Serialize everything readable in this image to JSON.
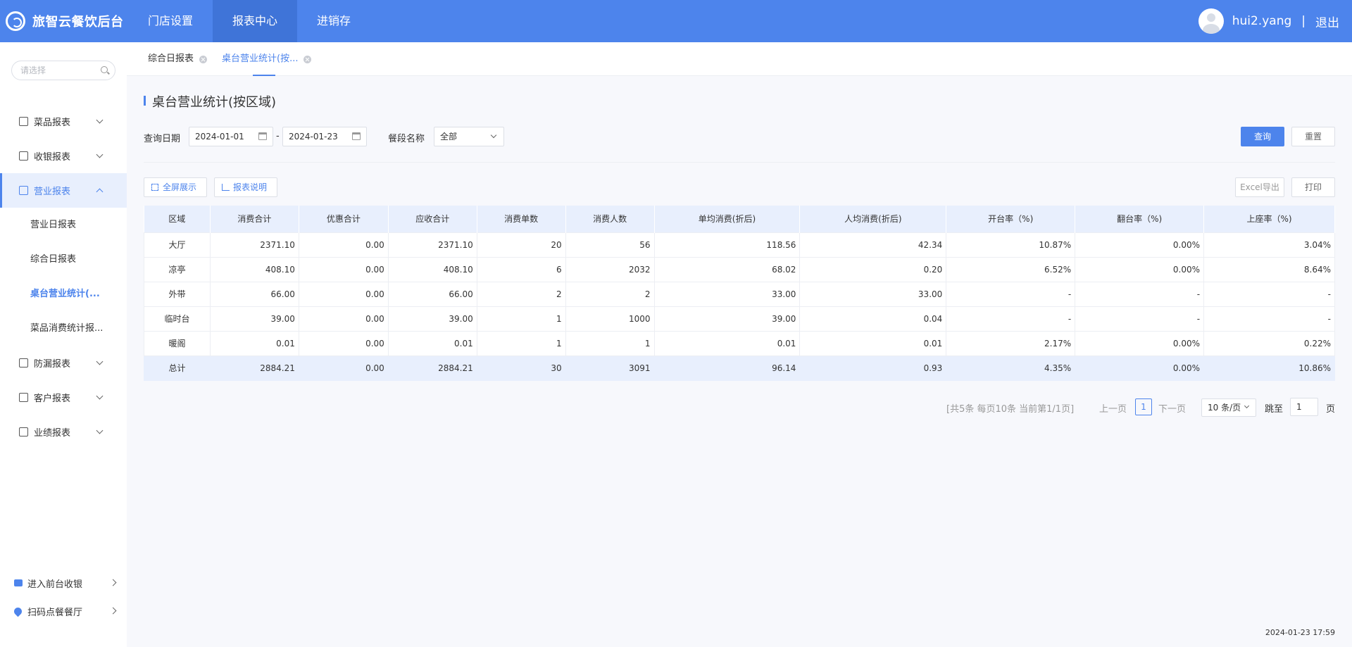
{
  "app": {
    "brand": "旅智云餐饮后台"
  },
  "topnav": [
    {
      "label": "门店设置"
    },
    {
      "label": "报表中心"
    },
    {
      "label": "进销存"
    }
  ],
  "user": {
    "name": "hui2.yang",
    "separator": "|",
    "logout": "退出"
  },
  "sidebar": {
    "search_placeholder": "请选择",
    "menu": [
      {
        "label": "菜品报表"
      },
      {
        "label": "收银报表"
      },
      {
        "label": "营业报表"
      }
    ],
    "submenu": [
      {
        "label": "营业日报表"
      },
      {
        "label": "综合日报表"
      },
      {
        "label": "桌台营业统计(..."
      },
      {
        "label": "菜品消费统计报..."
      }
    ],
    "menu2": [
      {
        "label": "防漏报表"
      },
      {
        "label": "客户报表"
      },
      {
        "label": "业绩报表"
      }
    ],
    "bottom": [
      {
        "label": "进入前台收银"
      },
      {
        "label": "扫码点餐餐厅"
      }
    ]
  },
  "tabs": [
    {
      "label": "综合日报表"
    },
    {
      "label": "桌台营业统计(按..."
    }
  ],
  "page": {
    "title": "桌台营业统计(按区域)",
    "filters": {
      "date_label": "查询日期",
      "start_date": "2024-01-01",
      "date_sep": "-",
      "end_date": "2024-01-23",
      "meal_label": "餐段名称",
      "meal_value": "全部"
    },
    "buttons": {
      "query": "查询",
      "reset": "重置",
      "fullscreen": "全屏展示",
      "explain": "报表说明",
      "excel": "Excel导出",
      "print": "打印"
    }
  },
  "table": {
    "headers": [
      "区域",
      "消费合计",
      "优惠合计",
      "应收合计",
      "消费单数",
      "消费人数",
      "单均消费(折后)",
      "人均消费(折后)",
      "开台率（%)",
      "翻台率（%)",
      "上座率（%)"
    ],
    "rows": [
      [
        "大厅",
        "2371.10",
        "0.00",
        "2371.10",
        "20",
        "56",
        "118.56",
        "42.34",
        "10.87%",
        "0.00%",
        "3.04%"
      ],
      [
        "凉亭",
        "408.10",
        "0.00",
        "408.10",
        "6",
        "2032",
        "68.02",
        "0.20",
        "6.52%",
        "0.00%",
        "8.64%"
      ],
      [
        "外带",
        "66.00",
        "0.00",
        "66.00",
        "2",
        "2",
        "33.00",
        "33.00",
        "-",
        "-",
        "-"
      ],
      [
        "临时台",
        "39.00",
        "0.00",
        "39.00",
        "1",
        "1000",
        "39.00",
        "0.04",
        "-",
        "-",
        "-"
      ],
      [
        "暖阁",
        "0.01",
        "0.00",
        "0.01",
        "1",
        "1",
        "0.01",
        "0.01",
        "2.17%",
        "0.00%",
        "0.22%"
      ],
      [
        "总计",
        "2884.21",
        "0.00",
        "2884.21",
        "30",
        "3091",
        "96.14",
        "0.93",
        "4.35%",
        "0.00%",
        "10.86%"
      ]
    ]
  },
  "pagination": {
    "info": "[共5条 每页10条 当前第1/1页]",
    "prev": "上一页",
    "current": "1",
    "next": "下一页",
    "page_size": "10 条/页",
    "jump_label": "跳至",
    "jump_value": "1",
    "page_suffix": "页"
  },
  "footer": {
    "timestamp": "2024-01-23 17:59"
  }
}
